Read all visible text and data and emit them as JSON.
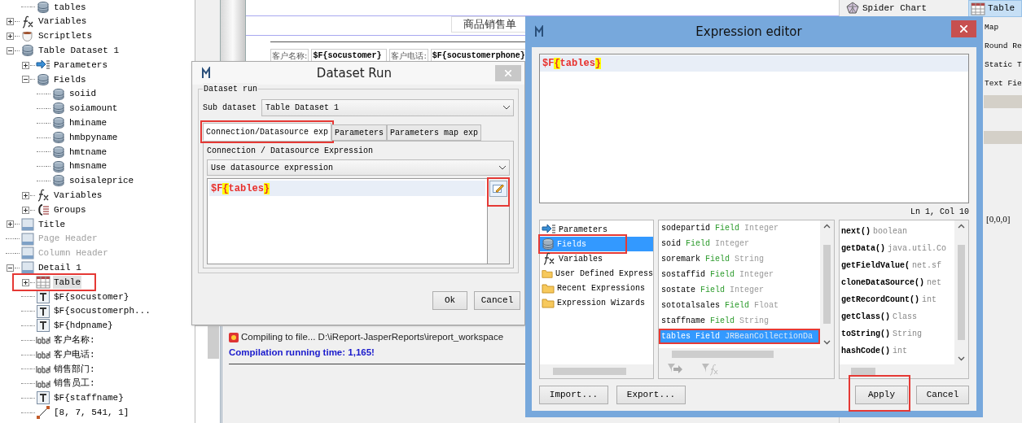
{
  "tree": {
    "cut_parent_children": [
      {
        "kind": "field",
        "label": "tables",
        "selected": false
      }
    ],
    "items": [
      {
        "kind": "variables",
        "label": "Variables",
        "expanded": false,
        "selected": false
      },
      {
        "kind": "scriptlets",
        "label": "Scriptlets",
        "expanded": false,
        "selected": false
      },
      {
        "kind": "dataset",
        "label": "Table Dataset 1",
        "expanded": true,
        "selected": false,
        "children": [
          {
            "kind": "parameters",
            "label": "Parameters",
            "expanded": false,
            "selected": false
          },
          {
            "kind": "field",
            "label": "Fields",
            "expanded": true,
            "selected": false,
            "children": [
              {
                "kind": "field",
                "label": "soiid",
                "selected": false
              },
              {
                "kind": "field",
                "label": "soiamount",
                "selected": false
              },
              {
                "kind": "field",
                "label": "hminame",
                "selected": false
              },
              {
                "kind": "field",
                "label": "hmbpyname",
                "selected": false
              },
              {
                "kind": "field",
                "label": "hmtname",
                "selected": false
              },
              {
                "kind": "field",
                "label": "hmsname",
                "selected": false
              },
              {
                "kind": "field",
                "label": "soisaleprice",
                "selected": false
              }
            ]
          },
          {
            "kind": "variables",
            "label": "Variables",
            "expanded": false,
            "selected": false
          },
          {
            "kind": "groups",
            "label": "Groups",
            "expanded": false,
            "selected": false
          }
        ]
      },
      {
        "kind": "band",
        "label": "Title",
        "expanded": false,
        "selected": false,
        "disabled": false
      },
      {
        "kind": "band",
        "label": "Page Header",
        "selected": false,
        "disabled": true
      },
      {
        "kind": "band",
        "label": "Column Header",
        "selected": false,
        "disabled": true
      },
      {
        "kind": "band",
        "label": "Detail 1",
        "expanded": true,
        "selected": false,
        "disabled": false,
        "children": [
          {
            "kind": "table",
            "label": "Table",
            "expanded": false,
            "selected": true,
            "annotated": true
          },
          {
            "kind": "textfield",
            "label": "$F{socustomer}",
            "selected": false
          },
          {
            "kind": "textfield",
            "label": "$F{socustomerph...",
            "selected": false
          },
          {
            "kind": "textfield",
            "label": "$F{hdpname}",
            "selected": false
          },
          {
            "kind": "label",
            "label": "客户名称:",
            "selected": false
          },
          {
            "kind": "label",
            "label": "客户电话:",
            "selected": false
          },
          {
            "kind": "label",
            "label": "销售部门:",
            "selected": false
          },
          {
            "kind": "label",
            "label": "销售员工:",
            "selected": false
          },
          {
            "kind": "textfield",
            "label": "$F{staffname}",
            "selected": false
          },
          {
            "kind": "line",
            "label": "[8, 7, 541, 1]",
            "selected": false
          }
        ]
      }
    ]
  },
  "designer": {
    "title": "商品销售单",
    "cells": [
      {
        "kind": "label",
        "text": "客户名称:"
      },
      {
        "kind": "field",
        "text": "$F{socustomer}"
      },
      {
        "kind": "label",
        "text": "客户电话:"
      },
      {
        "kind": "field",
        "text": "$F{socustomerphone}"
      }
    ]
  },
  "output": {
    "lines": [
      {
        "kind": "info",
        "text": "Compiling to file... D:\\iReport-JasperReports\\ireport_workspace"
      },
      {
        "kind": "time",
        "text": "Compilation running time: 1,165!"
      }
    ]
  },
  "palette": {
    "items": [
      {
        "kind": "spider",
        "label": "Spider Chart",
        "selected": false
      },
      {
        "kind": "table",
        "label": "Table",
        "selected": true
      },
      {
        "kind": "none",
        "label": "Map",
        "selected": false
      },
      {
        "kind": "none",
        "label": "Round Re",
        "selected": false
      },
      {
        "kind": "none",
        "label": "Static T",
        "selected": false
      },
      {
        "kind": "none",
        "label": "Text Fie",
        "selected": false
      }
    ]
  },
  "properties": {
    "value": "[0,0,0]"
  },
  "dataset_run": {
    "title": "Dataset Run",
    "group_label": "Dataset run",
    "sub_dataset_label": "Sub dataset",
    "sub_dataset": "Table Dataset 1",
    "tabs": [
      {
        "label": "Connection/Datasource exp",
        "selected": true,
        "annotated": true
      },
      {
        "label": "Parameters",
        "selected": false
      },
      {
        "label": "Parameters map exp",
        "selected": false
      }
    ],
    "expression_label": "Connection / Datasource Expression",
    "expression_mode": "Use datasource expression",
    "expression": "$F{tables}",
    "edit_button": {
      "annotated": true
    },
    "buttons": [
      {
        "label": "Ok"
      },
      {
        "label": "Cancel"
      }
    ]
  },
  "expression_editor": {
    "title": "Expression editor",
    "expression": "$F{tables}",
    "cursor_position": "Ln 1, Col 10",
    "categories": [
      {
        "kind": "parameters",
        "label": "Parameters",
        "selected": false
      },
      {
        "kind": "fields",
        "label": "Fields",
        "selected": true,
        "annotated": true
      },
      {
        "kind": "variables",
        "label": "Variables",
        "selected": false
      },
      {
        "kind": "folder",
        "label": "User Defined Express",
        "selected": false
      },
      {
        "kind": "folder",
        "label": "Recent Expressions",
        "selected": false
      },
      {
        "kind": "folder",
        "label": "Expression Wizards",
        "selected": false
      }
    ],
    "fields": [
      {
        "name": "sodepartid",
        "label": "Field",
        "type": "Integer",
        "selected": false
      },
      {
        "name": "soid",
        "label": "Field",
        "type": "Integer",
        "selected": false
      },
      {
        "name": "soremark",
        "label": "Field",
        "type": "String",
        "selected": false
      },
      {
        "name": "sostaffid",
        "label": "Field",
        "type": "Integer",
        "selected": false
      },
      {
        "name": "sostate",
        "label": "Field",
        "type": "Integer",
        "selected": false
      },
      {
        "name": "sototalsales",
        "label": "Field",
        "type": "Float",
        "selected": false
      },
      {
        "name": "staffname",
        "label": "Field",
        "type": "String",
        "selected": false
      },
      {
        "name": "tables",
        "label": "Field",
        "type": "JRBeanCollectionDa",
        "selected": true,
        "annotated": true
      }
    ],
    "methods": [
      {
        "name": "next()",
        "type": "boolean"
      },
      {
        "name": "getData()",
        "type": "java.util.Co"
      },
      {
        "name": "getFieldValue(",
        "type": "net.sf"
      },
      {
        "name": "cloneDataSource()",
        "type": "net"
      },
      {
        "name": "getRecordCount()",
        "type": "int"
      },
      {
        "name": "getClass()",
        "type": "Class"
      },
      {
        "name": "toString()",
        "type": "String"
      },
      {
        "name": "hashCode()",
        "type": "int"
      }
    ],
    "buttons": [
      {
        "label": "Import..."
      },
      {
        "label": "Export..."
      },
      {
        "label": "Apply",
        "annotated": true
      },
      {
        "label": "Cancel"
      }
    ]
  }
}
